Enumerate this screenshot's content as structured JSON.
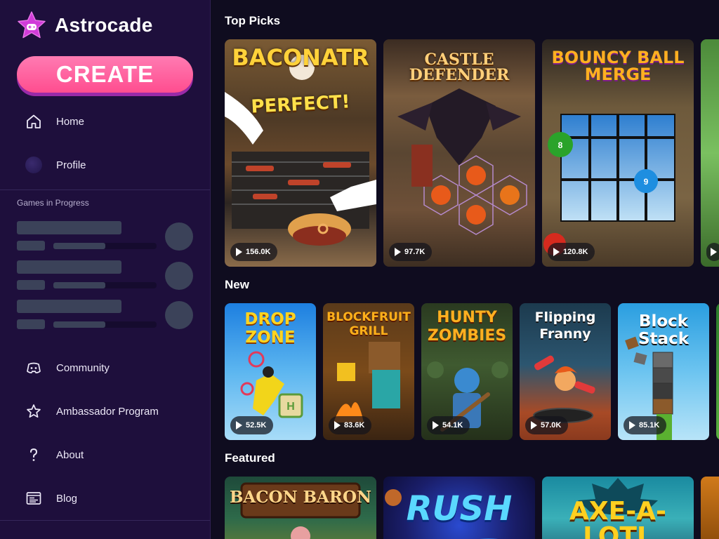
{
  "app": {
    "name": "Astrocade"
  },
  "sidebar": {
    "create_label": "CREATE",
    "nav_top": [
      {
        "label": "Home",
        "icon": "home-icon"
      },
      {
        "label": "Profile",
        "icon": "avatar-icon"
      }
    ],
    "games_in_progress_label": "Games in Progress",
    "nav_bottom": [
      {
        "label": "Community",
        "icon": "discord-icon"
      },
      {
        "label": "Ambassador Program",
        "icon": "star-outline-icon"
      },
      {
        "label": "About",
        "icon": "question-icon"
      },
      {
        "label": "Blog",
        "icon": "blog-icon"
      }
    ]
  },
  "sections": [
    {
      "title": "Top Picks",
      "games": [
        {
          "title": "BACONATR",
          "subtitle": "PERFECT!",
          "plays": "156.0K"
        },
        {
          "title": "CASTLE DEFENDER",
          "plays": "97.7K"
        },
        {
          "title": "BOUNCY BALL MERGE",
          "plays": "120.8K"
        },
        {
          "title": ""
        }
      ]
    },
    {
      "title": "New",
      "games": [
        {
          "title": "DROP ZONE",
          "plays": "52.5K"
        },
        {
          "title": "BLOCKFRUIT GRILL",
          "plays": "83.6K"
        },
        {
          "title": "HUNTY ZOMBIES",
          "plays": "54.1K"
        },
        {
          "title": "Flipping Franny",
          "plays": "57.0K"
        },
        {
          "title": "Block Stack",
          "plays": "85.1K"
        }
      ]
    },
    {
      "title": "Featured",
      "games": [
        {
          "title": "BACON BARON"
        },
        {
          "title": "RUSH"
        },
        {
          "title": "AXE-A-LOTL"
        }
      ]
    }
  ],
  "colors": {
    "sidebar_bg": "#1e0f3c",
    "page_bg": "#0f0c1f",
    "create_button": "#ff5a98",
    "skeleton": "#3b4259"
  }
}
